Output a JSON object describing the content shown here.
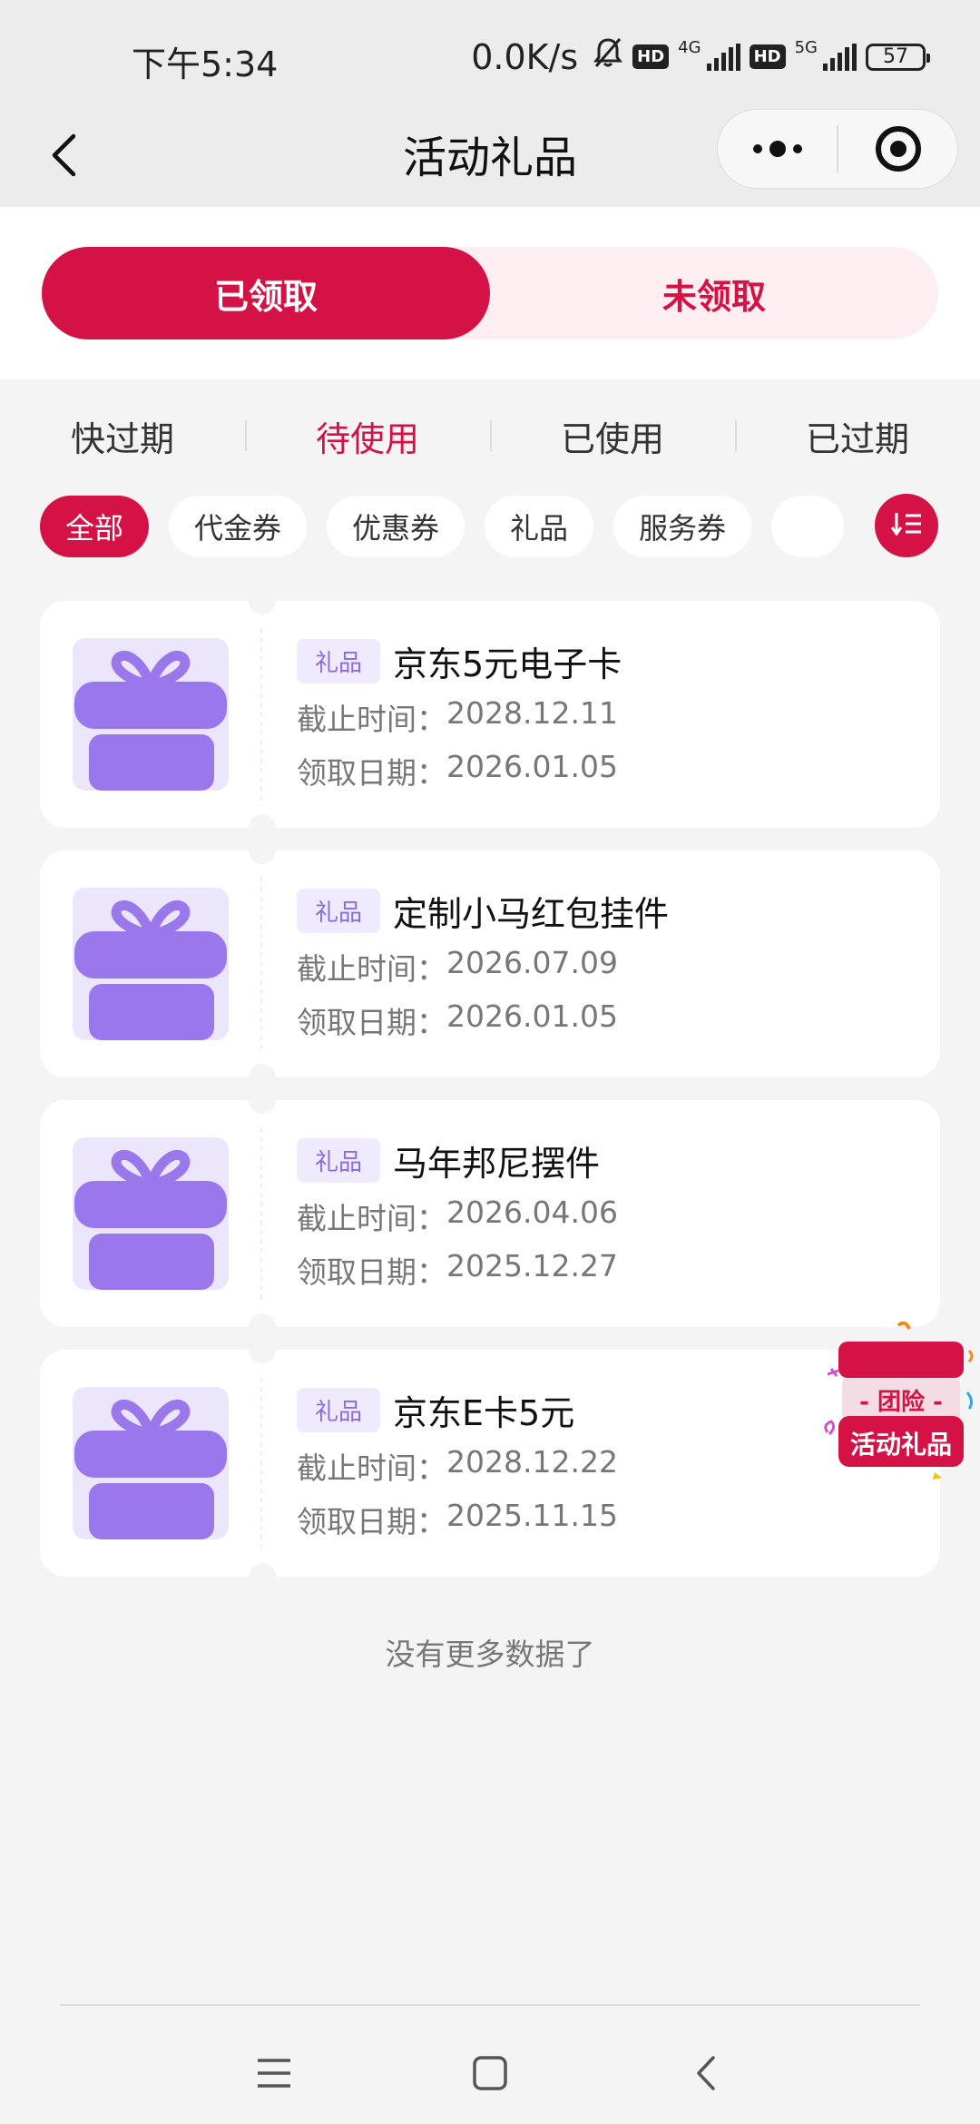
{
  "status_bar": {
    "time": "下午5:34",
    "speed": "0.0K/s",
    "hd1": "HD",
    "net1": "4G",
    "hd2": "HD",
    "net2": "5G",
    "battery": "57"
  },
  "nav": {
    "title": "活动礼品"
  },
  "segment": {
    "items": [
      {
        "label": "已领取",
        "active": true
      },
      {
        "label": "未领取",
        "active": false
      }
    ]
  },
  "status_tabs": [
    {
      "label": "快过期",
      "active": false
    },
    {
      "label": "待使用",
      "active": true
    },
    {
      "label": "已使用",
      "active": false
    },
    {
      "label": "已过期",
      "active": false
    }
  ],
  "chips": [
    {
      "label": "全部",
      "active": true
    },
    {
      "label": "代金券",
      "active": false
    },
    {
      "label": "优惠券",
      "active": false
    },
    {
      "label": "礼品",
      "active": false
    },
    {
      "label": "服务券",
      "active": false
    }
  ],
  "labels": {
    "deadline": "截止时间：",
    "received": "领取日期："
  },
  "gifts": [
    {
      "tag": "礼品",
      "name": "京东5元电子卡",
      "deadline": "2028.12.11",
      "received": "2026.01.05"
    },
    {
      "tag": "礼品",
      "name": "定制小马红包挂件",
      "deadline": "2026.07.09",
      "received": "2026.01.05"
    },
    {
      "tag": "礼品",
      "name": "马年邦尼摆件",
      "deadline": "2026.04.06",
      "received": "2025.12.27"
    },
    {
      "tag": "礼品",
      "name": "京东E卡5元",
      "deadline": "2028.12.22",
      "received": "2025.11.15"
    }
  ],
  "footer_text": "没有更多数据了",
  "promo": {
    "line1": "- 团险 -",
    "line2": "活动礼品"
  },
  "colors": {
    "accent": "#d41245",
    "accent_light": "#fdeef1",
    "gift_purple": "#9a78ec",
    "gift_bg": "#ebe6fb"
  },
  "icons": {
    "back": "chevron-left-icon",
    "more": "more-dots-icon",
    "close": "target-circle-icon",
    "sort": "sort-icon",
    "gift": "gift-box-icon",
    "menu": "menu-icon",
    "home": "home-square-icon",
    "sys_back": "chevron-left-icon"
  }
}
